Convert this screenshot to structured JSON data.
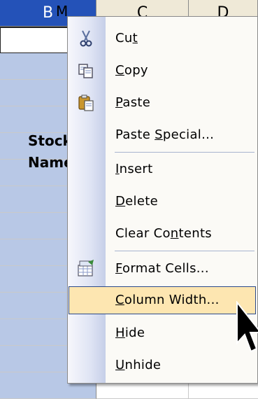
{
  "sheet": {
    "columns": [
      "B",
      "C",
      "D"
    ],
    "selected_column": "B",
    "b1_text": "M",
    "b_cells": [
      "Stock",
      "Name"
    ],
    "colors": {
      "selected_header": "#2452b8",
      "selected_cells": "#b8c8e6",
      "header": "#efe9d7"
    }
  },
  "context_menu": {
    "items": [
      {
        "pre": "Cu",
        "u": "t",
        "post": "",
        "icon": "scissors-icon"
      },
      {
        "pre": "",
        "u": "C",
        "post": "opy",
        "icon": "copy-icon"
      },
      {
        "pre": "",
        "u": "P",
        "post": "aste",
        "icon": "paste-icon"
      },
      {
        "pre": "Paste ",
        "u": "S",
        "post": "pecial...",
        "icon": ""
      },
      {
        "pre": "",
        "u": "I",
        "post": "nsert",
        "icon": ""
      },
      {
        "pre": "",
        "u": "D",
        "post": "elete",
        "icon": ""
      },
      {
        "pre": "Clear Co",
        "u": "n",
        "post": "tents",
        "icon": ""
      },
      {
        "pre": "",
        "u": "F",
        "post": "ormat Cells...",
        "icon": "format-cells-icon"
      },
      {
        "pre": "",
        "u": "C",
        "post": "olumn Width...",
        "icon": "",
        "highlighted": true
      },
      {
        "pre": "",
        "u": "H",
        "post": "ide",
        "icon": ""
      },
      {
        "pre": "",
        "u": "U",
        "post": "nhide",
        "icon": ""
      }
    ],
    "highlight_color": "#fde6b1"
  }
}
